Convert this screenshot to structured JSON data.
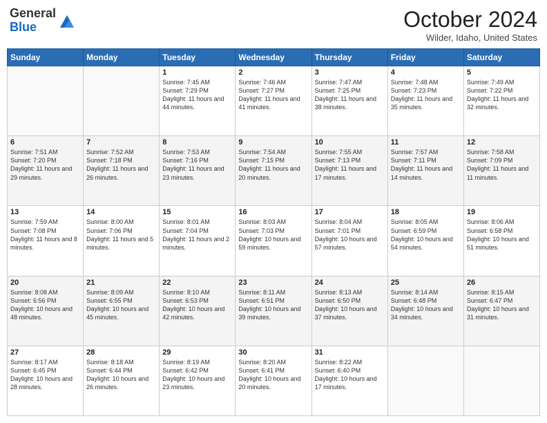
{
  "header": {
    "logo_line1": "General",
    "logo_line2": "Blue",
    "month": "October 2024",
    "location": "Wilder, Idaho, United States"
  },
  "days_of_week": [
    "Sunday",
    "Monday",
    "Tuesday",
    "Wednesday",
    "Thursday",
    "Friday",
    "Saturday"
  ],
  "weeks": [
    [
      {
        "day": "",
        "info": ""
      },
      {
        "day": "",
        "info": ""
      },
      {
        "day": "1",
        "info": "Sunrise: 7:45 AM\nSunset: 7:29 PM\nDaylight: 11 hours and 44 minutes."
      },
      {
        "day": "2",
        "info": "Sunrise: 7:46 AM\nSunset: 7:27 PM\nDaylight: 11 hours and 41 minutes."
      },
      {
        "day": "3",
        "info": "Sunrise: 7:47 AM\nSunset: 7:25 PM\nDaylight: 11 hours and 38 minutes."
      },
      {
        "day": "4",
        "info": "Sunrise: 7:48 AM\nSunset: 7:23 PM\nDaylight: 11 hours and 35 minutes."
      },
      {
        "day": "5",
        "info": "Sunrise: 7:49 AM\nSunset: 7:22 PM\nDaylight: 11 hours and 32 minutes."
      }
    ],
    [
      {
        "day": "6",
        "info": "Sunrise: 7:51 AM\nSunset: 7:20 PM\nDaylight: 11 hours and 29 minutes."
      },
      {
        "day": "7",
        "info": "Sunrise: 7:52 AM\nSunset: 7:18 PM\nDaylight: 11 hours and 26 minutes."
      },
      {
        "day": "8",
        "info": "Sunrise: 7:53 AM\nSunset: 7:16 PM\nDaylight: 11 hours and 23 minutes."
      },
      {
        "day": "9",
        "info": "Sunrise: 7:54 AM\nSunset: 7:15 PM\nDaylight: 11 hours and 20 minutes."
      },
      {
        "day": "10",
        "info": "Sunrise: 7:55 AM\nSunset: 7:13 PM\nDaylight: 11 hours and 17 minutes."
      },
      {
        "day": "11",
        "info": "Sunrise: 7:57 AM\nSunset: 7:11 PM\nDaylight: 11 hours and 14 minutes."
      },
      {
        "day": "12",
        "info": "Sunrise: 7:58 AM\nSunset: 7:09 PM\nDaylight: 11 hours and 11 minutes."
      }
    ],
    [
      {
        "day": "13",
        "info": "Sunrise: 7:59 AM\nSunset: 7:08 PM\nDaylight: 11 hours and 8 minutes."
      },
      {
        "day": "14",
        "info": "Sunrise: 8:00 AM\nSunset: 7:06 PM\nDaylight: 11 hours and 5 minutes."
      },
      {
        "day": "15",
        "info": "Sunrise: 8:01 AM\nSunset: 7:04 PM\nDaylight: 11 hours and 2 minutes."
      },
      {
        "day": "16",
        "info": "Sunrise: 8:03 AM\nSunset: 7:03 PM\nDaylight: 10 hours and 59 minutes."
      },
      {
        "day": "17",
        "info": "Sunrise: 8:04 AM\nSunset: 7:01 PM\nDaylight: 10 hours and 57 minutes."
      },
      {
        "day": "18",
        "info": "Sunrise: 8:05 AM\nSunset: 6:59 PM\nDaylight: 10 hours and 54 minutes."
      },
      {
        "day": "19",
        "info": "Sunrise: 8:06 AM\nSunset: 6:58 PM\nDaylight: 10 hours and 51 minutes."
      }
    ],
    [
      {
        "day": "20",
        "info": "Sunrise: 8:08 AM\nSunset: 6:56 PM\nDaylight: 10 hours and 48 minutes."
      },
      {
        "day": "21",
        "info": "Sunrise: 8:09 AM\nSunset: 6:55 PM\nDaylight: 10 hours and 45 minutes."
      },
      {
        "day": "22",
        "info": "Sunrise: 8:10 AM\nSunset: 6:53 PM\nDaylight: 10 hours and 42 minutes."
      },
      {
        "day": "23",
        "info": "Sunrise: 8:11 AM\nSunset: 6:51 PM\nDaylight: 10 hours and 39 minutes."
      },
      {
        "day": "24",
        "info": "Sunrise: 8:13 AM\nSunset: 6:50 PM\nDaylight: 10 hours and 37 minutes."
      },
      {
        "day": "25",
        "info": "Sunrise: 8:14 AM\nSunset: 6:48 PM\nDaylight: 10 hours and 34 minutes."
      },
      {
        "day": "26",
        "info": "Sunrise: 8:15 AM\nSunset: 6:47 PM\nDaylight: 10 hours and 31 minutes."
      }
    ],
    [
      {
        "day": "27",
        "info": "Sunrise: 8:17 AM\nSunset: 6:45 PM\nDaylight: 10 hours and 28 minutes."
      },
      {
        "day": "28",
        "info": "Sunrise: 8:18 AM\nSunset: 6:44 PM\nDaylight: 10 hours and 26 minutes."
      },
      {
        "day": "29",
        "info": "Sunrise: 8:19 AM\nSunset: 6:42 PM\nDaylight: 10 hours and 23 minutes."
      },
      {
        "day": "30",
        "info": "Sunrise: 8:20 AM\nSunset: 6:41 PM\nDaylight: 10 hours and 20 minutes."
      },
      {
        "day": "31",
        "info": "Sunrise: 8:22 AM\nSunset: 6:40 PM\nDaylight: 10 hours and 17 minutes."
      },
      {
        "day": "",
        "info": ""
      },
      {
        "day": "",
        "info": ""
      }
    ]
  ]
}
